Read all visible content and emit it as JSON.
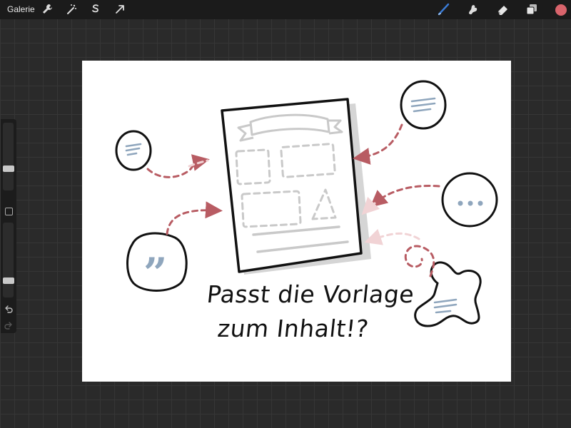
{
  "topbar": {
    "gallery_label": "Galerie",
    "left_tools": [
      "wrench-icon",
      "magic-wand-icon",
      "selection-icon",
      "transform-arrow-icon"
    ],
    "right_tools": [
      "brush-icon",
      "smudge-icon",
      "eraser-icon",
      "layers-icon",
      "color-swatch"
    ],
    "brush_color": "#3a7bd5",
    "current_color": "#d9646c"
  },
  "sidebar": {
    "brush_size_level": 0.3,
    "opacity_level": 0.2
  },
  "canvas": {
    "caption_line1": "Passt die Vorlage",
    "caption_line2": "zum Inhalt!?",
    "accent_red": "#b85c63",
    "accent_blue": "#8fa6bd",
    "quote_mark": "”"
  }
}
